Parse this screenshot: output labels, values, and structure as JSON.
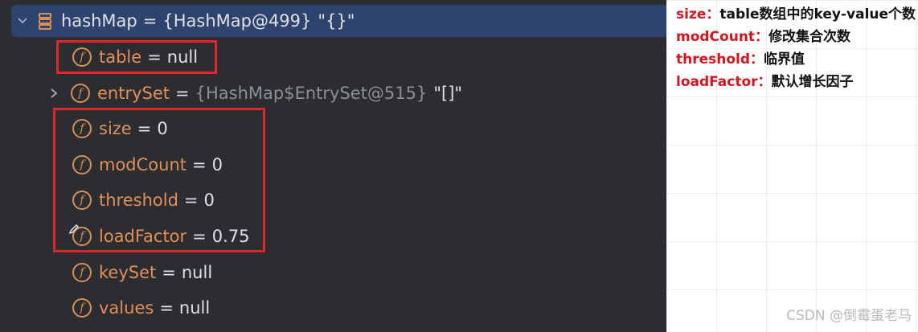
{
  "debugger": {
    "root": {
      "name": "hashMap",
      "equals": "=",
      "ref": "{HashMap@499}",
      "string_value": "\"{}\""
    },
    "fields": [
      {
        "name": "table",
        "equals": "=",
        "value": "null"
      },
      {
        "name": "entrySet",
        "equals": "=",
        "ref": "{HashMap$EntrySet@515}",
        "string_value": "\"[]\""
      },
      {
        "name": "size",
        "equals": "=",
        "value": "0"
      },
      {
        "name": "modCount",
        "equals": "=",
        "value": "0"
      },
      {
        "name": "threshold",
        "equals": "=",
        "value": "0"
      },
      {
        "name": "loadFactor",
        "equals": "=",
        "value": "0.75"
      },
      {
        "name": "keySet",
        "equals": "=",
        "value": "null"
      },
      {
        "name": "values",
        "equals": "=",
        "value": "null"
      }
    ],
    "field_icon_glyph": "f"
  },
  "notes": [
    {
      "key": "size：",
      "desc": "table数组中的key-value个数"
    },
    {
      "key": "modCount：",
      "desc": "修改集合次数"
    },
    {
      "key": "threshold：",
      "desc": "临界值"
    },
    {
      "key": "loadFactor：",
      "desc": "默认增长因子"
    }
  ],
  "watermark": "CSDN @倒霉蛋老马",
  "colors": {
    "panel_bg": "#2b2d30",
    "selected_row_bg": "#2e436e",
    "field_name": "#e28f5c",
    "highlight_border": "#e0272e",
    "note_key": "#d01520"
  },
  "icons": [
    "chevron-down-icon",
    "database-icon",
    "field-icon",
    "chevron-right-icon",
    "pencil-icon"
  ]
}
